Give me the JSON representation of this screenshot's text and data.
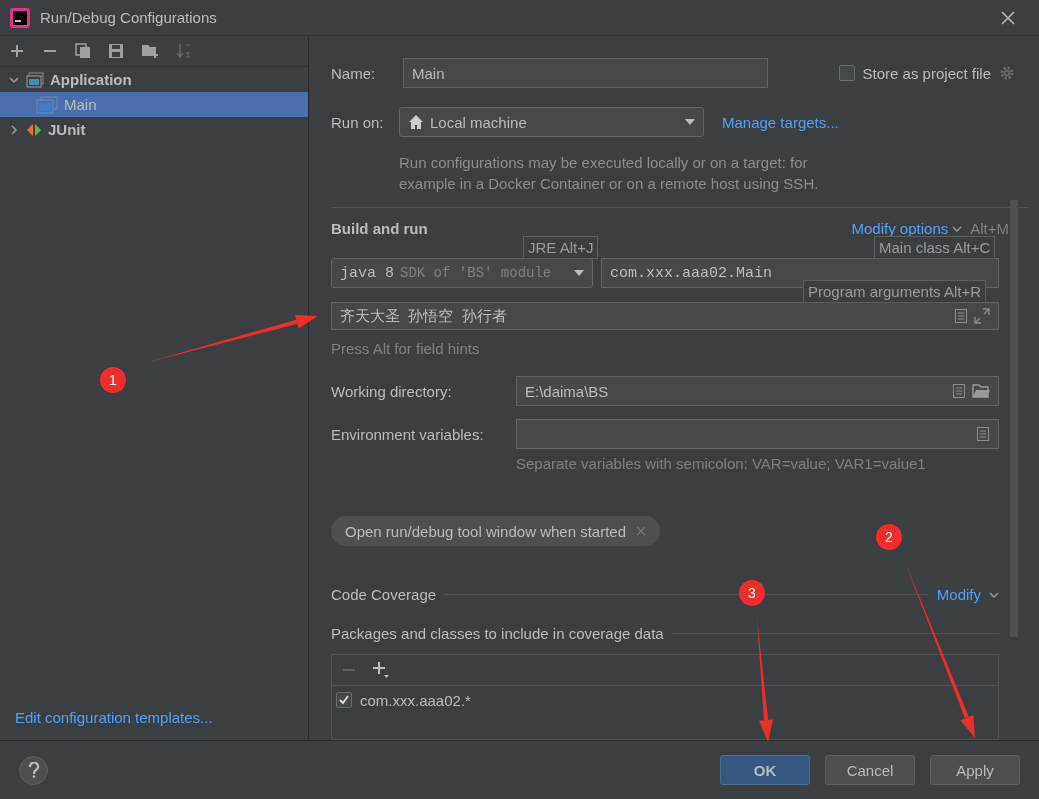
{
  "window": {
    "title": "Run/Debug Configurations"
  },
  "tree": [
    {
      "label": "Application",
      "expanded": true,
      "selected": false,
      "children": [
        {
          "label": "Main",
          "selected": true
        }
      ]
    },
    {
      "label": "JUnit",
      "expanded": false,
      "selected": false
    }
  ],
  "templates_link": "Edit configuration templates...",
  "form": {
    "name_label": "Name:",
    "name_value": "Main",
    "store_checkbox": {
      "label": "Store as project file",
      "checked": false
    },
    "run_on_label": "Run on:",
    "run_on_value": "Local machine",
    "manage_link": "Manage targets...",
    "description": "Run configurations may be executed locally or on a target: for example in a Docker Container or on a remote host using SSH.",
    "section_title": "Build and run",
    "modify_link": "Modify options",
    "modify_shortcut": "Alt+M",
    "jdk": {
      "value": "java 8",
      "hint": "SDK of 'BS' module"
    },
    "main_class": "com.xxx.aaa02.Main",
    "program_arguments": "齐天大圣  孙悟空  孙行者",
    "field_hint": "Press Alt for field hints",
    "working_dir_label": "Working directory:",
    "working_dir_value": "E:\\daima\\BS",
    "env_label": "Environment variables:",
    "env_hint": "Separate variables with semicolon: VAR=value; VAR1=value1",
    "option_chip": "Open run/debug tool window when started",
    "coverage_title": "Code Coverage",
    "coverage_modify": "Modify",
    "packages_title": "Packages and classes to include in coverage data",
    "packages": [
      {
        "label": "com.xxx.aaa02.*",
        "checked": true
      }
    ]
  },
  "tooltips": [
    {
      "text": "JRE Alt+J"
    },
    {
      "text": "Main class Alt+C"
    },
    {
      "text": "Program arguments Alt+R"
    }
  ],
  "buttons": [
    {
      "label": "OK",
      "default": true
    },
    {
      "label": "Cancel",
      "default": false
    },
    {
      "label": "Apply",
      "default": false
    }
  ],
  "annotations": [
    {
      "label": "1"
    },
    {
      "label": "2"
    },
    {
      "label": "3"
    }
  ]
}
